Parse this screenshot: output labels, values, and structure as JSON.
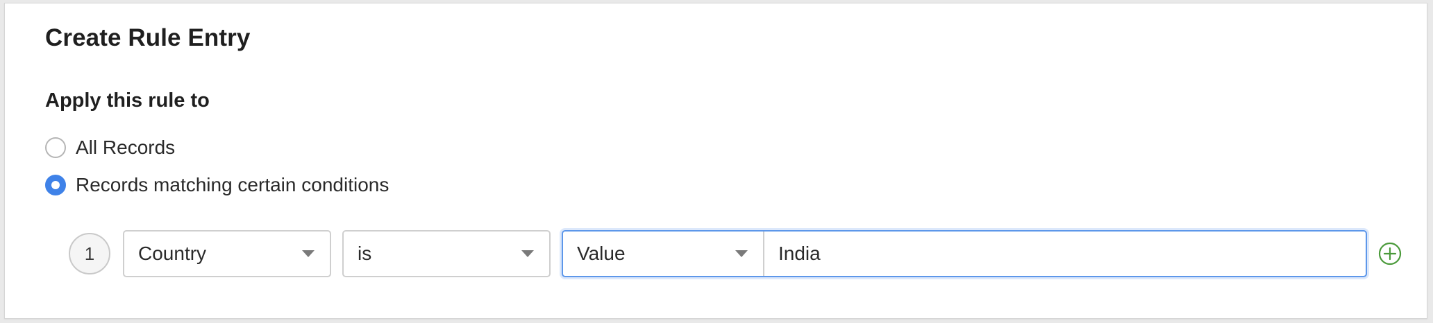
{
  "dialog": {
    "title": "Create Rule Entry",
    "section_title": "Apply this rule to"
  },
  "apply_options": [
    {
      "label": "All Records",
      "selected": false
    },
    {
      "label": "Records matching certain conditions",
      "selected": true
    }
  ],
  "condition": {
    "index": "1",
    "field": "Country",
    "operator": "is",
    "value_type": "Value",
    "value": "India",
    "add_icon": "plus-circle-icon"
  },
  "colors": {
    "accent": "#3f82e8",
    "add_icon": "#4a9a3a",
    "focus_border": "#5d97ea"
  }
}
